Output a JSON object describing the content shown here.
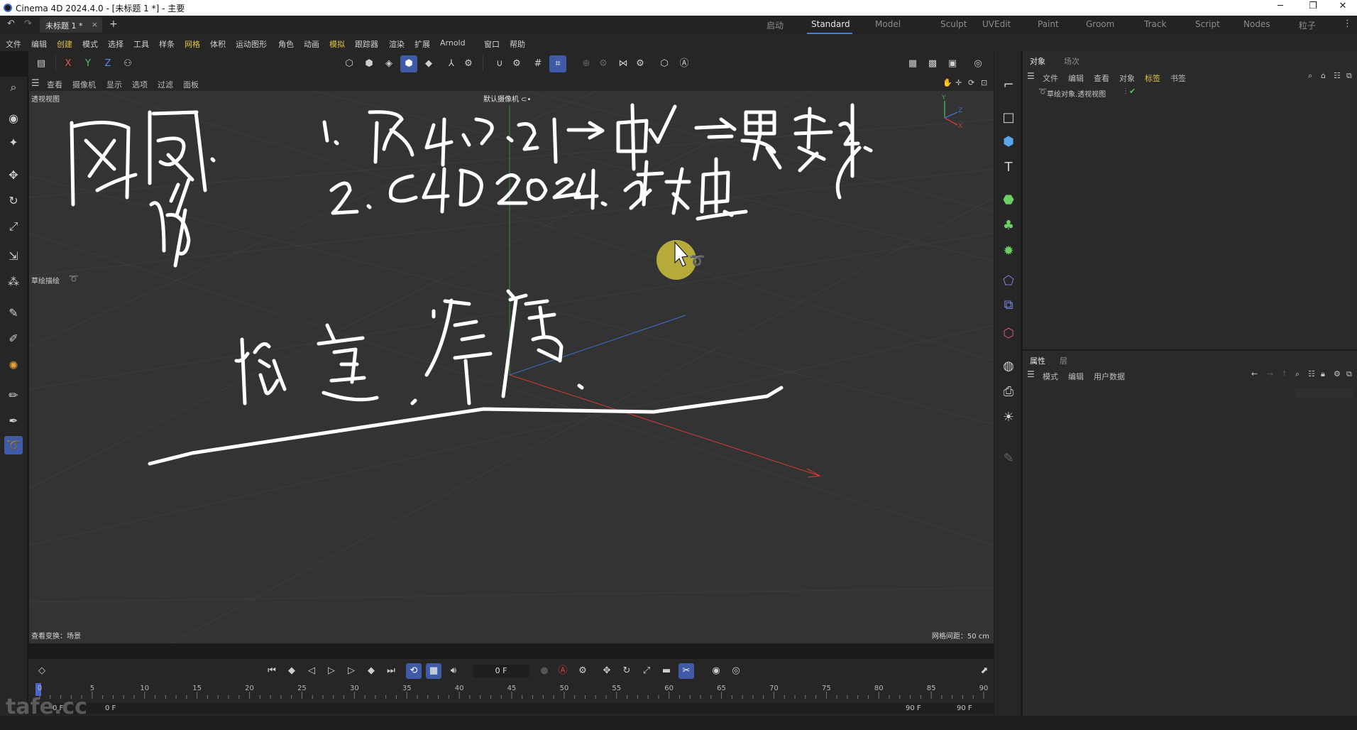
{
  "window": {
    "title": "Cinema 4D 2024.4.0 - [未标题 1 *] - 主要",
    "minimize": "─",
    "maximize": "❐",
    "close": "✕"
  },
  "tabs": {
    "document": "未标题 1 *",
    "close": "×",
    "add": "+",
    "layouts": [
      {
        "label": "启动",
        "active": false
      },
      {
        "label": "Standard",
        "active": true
      },
      {
        "label": "Model",
        "active": false
      },
      {
        "label": "Sculpt",
        "active": false
      },
      {
        "label": "UVEdit",
        "active": false
      },
      {
        "label": "Paint",
        "active": false
      },
      {
        "label": "Groom",
        "active": false
      },
      {
        "label": "Track",
        "active": false
      },
      {
        "label": "Script",
        "active": false
      },
      {
        "label": "Nodes",
        "active": false
      },
      {
        "label": "粒子",
        "active": false
      }
    ],
    "more": "⋮"
  },
  "menu": [
    "文件",
    "编辑",
    "创建",
    "模式",
    "选择",
    "工具",
    "样条",
    "网格",
    "体积",
    "运动图形",
    "角色",
    "动画",
    "模拟",
    "跟踪器",
    "渲染",
    "扩展",
    "Arnold",
    "窗口",
    "帮助"
  ],
  "menu_highlight": [
    "创建",
    "网格",
    "模拟"
  ],
  "axes": {
    "x": "X",
    "y": "Y",
    "z": "Z"
  },
  "viewport": {
    "menu": [
      "查看",
      "摄像机",
      "显示",
      "选项",
      "过滤",
      "面板"
    ],
    "name": "透视视图",
    "camera": "默认摄像机 ⊂•",
    "sketch_label": "草绘描绘",
    "transform_label": "查看变换：场景",
    "grid_label": "网格间距：50 cm"
  },
  "object_manager": {
    "tabs": [
      "对象",
      "场次"
    ],
    "menu": [
      "文件",
      "编辑",
      "查看",
      "对象",
      "标签",
      "书签"
    ],
    "highlight": "标签",
    "item": "草绘对象.透视视图"
  },
  "attribute_manager": {
    "tabs": [
      "属性",
      "层"
    ],
    "menu": [
      "模式",
      "编辑",
      "用户数据"
    ]
  },
  "timeline": {
    "current_frame": "0 F",
    "ticks": [
      "0",
      "5",
      "10",
      "15",
      "20",
      "25",
      "30",
      "35",
      "40",
      "45",
      "50",
      "55",
      "60",
      "65",
      "70",
      "75",
      "80",
      "85",
      "90"
    ],
    "start_frame": "0 F",
    "start_frame2": "0 F",
    "end_frame": "90 F",
    "end_frame2": "90 F"
  },
  "watermark": "tafe.cc",
  "colors": {
    "accent": "#3d7fe0",
    "highlight_menu": "#e3c342",
    "x_axis": "#d03a3a",
    "y_axis": "#3bb04e",
    "z_axis": "#3d6fd0"
  }
}
